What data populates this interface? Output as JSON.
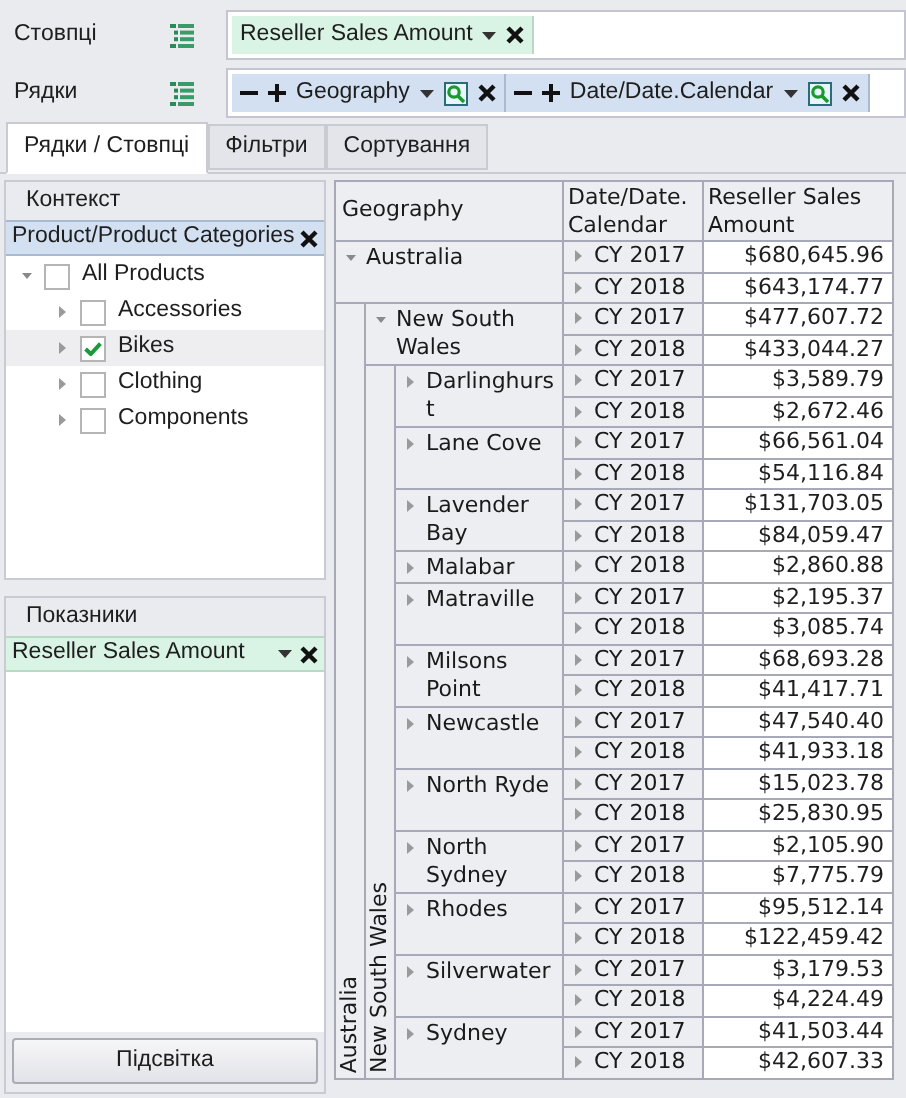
{
  "fields": [
    {
      "label": "Стовпці",
      "chips": [
        {
          "kind": "measure",
          "label": "Reseller Sales Amount"
        }
      ]
    },
    {
      "label": "Рядки",
      "chips": [
        {
          "kind": "dimension",
          "label": "Geography"
        },
        {
          "kind": "dimension",
          "label": "Date/Date.Calendar"
        }
      ]
    }
  ],
  "tabs": [
    {
      "label": "Рядки / Стовпці",
      "selected": true
    },
    {
      "label": "Фільтри",
      "selected": false
    },
    {
      "label": "Сортування",
      "selected": false
    }
  ],
  "context": {
    "title": "Контекст",
    "filter": "Product/Product Categories",
    "tree": [
      {
        "label": "All Products",
        "expanded": true,
        "checked": false,
        "selected": false,
        "children": [
          {
            "label": "Accessories",
            "expanded": false,
            "checked": false,
            "selected": false
          },
          {
            "label": "Bikes",
            "expanded": false,
            "checked": true,
            "selected": true
          },
          {
            "label": "Clothing",
            "expanded": false,
            "checked": false,
            "selected": false
          },
          {
            "label": "Components",
            "expanded": false,
            "checked": false,
            "selected": false
          }
        ]
      }
    ]
  },
  "measures": {
    "title": "Показники",
    "items": [
      "Reseller Sales Amount"
    ],
    "button": "Підсвітка"
  },
  "pivot": {
    "headers": [
      "Geography",
      "Date/Date. Calendar",
      "Reseller Sales Amount"
    ],
    "rows": [
      {
        "label": "Australia",
        "expanded": true,
        "vertical_label": "Australia",
        "periods": [
          {
            "label": "CY 2017",
            "expanded": false,
            "value": "$680,645.96"
          },
          {
            "label": "CY 2018",
            "expanded": false,
            "value": "$643,174.77"
          }
        ],
        "children": [
          {
            "label": "New South Wales",
            "expanded": true,
            "vertical_label": "New South Wales",
            "periods": [
              {
                "label": "CY 2017",
                "expanded": false,
                "value": "$477,607.72"
              },
              {
                "label": "CY 2018",
                "expanded": false,
                "value": "$433,044.27"
              }
            ],
            "children": [
              {
                "label": "Darlinghurst",
                "expanded": false,
                "periods": [
                  {
                    "label": "CY 2017",
                    "expanded": false,
                    "value": "$3,589.79"
                  },
                  {
                    "label": "CY 2018",
                    "expanded": false,
                    "value": "$2,672.46"
                  }
                ]
              },
              {
                "label": "Lane Cove",
                "expanded": false,
                "periods": [
                  {
                    "label": "CY 2017",
                    "expanded": false,
                    "value": "$66,561.04"
                  },
                  {
                    "label": "CY 2018",
                    "expanded": false,
                    "value": "$54,116.84"
                  }
                ]
              },
              {
                "label": "Lavender Bay",
                "expanded": false,
                "periods": [
                  {
                    "label": "CY 2017",
                    "expanded": false,
                    "value": "$131,703.05"
                  },
                  {
                    "label": "CY 2018",
                    "expanded": false,
                    "value": "$84,059.47"
                  }
                ]
              },
              {
                "label": "Malabar",
                "expanded": false,
                "periods": [
                  {
                    "label": "CY 2018",
                    "expanded": false,
                    "value": "$2,860.88"
                  }
                ]
              },
              {
                "label": "Matraville",
                "expanded": false,
                "periods": [
                  {
                    "label": "CY 2017",
                    "expanded": false,
                    "value": "$2,195.37"
                  },
                  {
                    "label": "CY 2018",
                    "expanded": false,
                    "value": "$3,085.74"
                  }
                ]
              },
              {
                "label": "Milsons Point",
                "expanded": false,
                "periods": [
                  {
                    "label": "CY 2017",
                    "expanded": false,
                    "value": "$68,693.28"
                  },
                  {
                    "label": "CY 2018",
                    "expanded": false,
                    "value": "$41,417.71"
                  }
                ]
              },
              {
                "label": "Newcastle",
                "expanded": false,
                "periods": [
                  {
                    "label": "CY 2017",
                    "expanded": false,
                    "value": "$47,540.40"
                  },
                  {
                    "label": "CY 2018",
                    "expanded": false,
                    "value": "$41,933.18"
                  }
                ]
              },
              {
                "label": "North Ryde",
                "expanded": false,
                "periods": [
                  {
                    "label": "CY 2017",
                    "expanded": false,
                    "value": "$15,023.78"
                  },
                  {
                    "label": "CY 2018",
                    "expanded": false,
                    "value": "$25,830.95"
                  }
                ]
              },
              {
                "label": "North Sydney",
                "expanded": false,
                "periods": [
                  {
                    "label": "CY 2017",
                    "expanded": false,
                    "value": "$2,105.90"
                  },
                  {
                    "label": "CY 2018",
                    "expanded": false,
                    "value": "$7,775.79"
                  }
                ]
              },
              {
                "label": "Rhodes",
                "expanded": false,
                "periods": [
                  {
                    "label": "CY 2017",
                    "expanded": false,
                    "value": "$95,512.14"
                  },
                  {
                    "label": "CY 2018",
                    "expanded": false,
                    "value": "$122,459.42"
                  }
                ]
              },
              {
                "label": "Silverwater",
                "expanded": false,
                "periods": [
                  {
                    "label": "CY 2017",
                    "expanded": false,
                    "value": "$3,179.53"
                  },
                  {
                    "label": "CY 2018",
                    "expanded": false,
                    "value": "$4,224.49"
                  }
                ]
              },
              {
                "label": "Sydney",
                "expanded": false,
                "periods": [
                  {
                    "label": "CY 2017",
                    "expanded": false,
                    "value": "$41,503.44"
                  },
                  {
                    "label": "CY 2018",
                    "expanded": false,
                    "value": "$42,607.33"
                  }
                ]
              }
            ]
          }
        ]
      }
    ]
  }
}
